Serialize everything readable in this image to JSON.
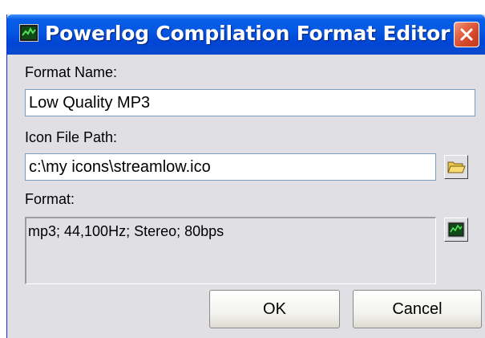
{
  "window": {
    "title": "Powerlog Compilation Format Editor",
    "app_icon": "chart-icon",
    "close_icon": "close-icon"
  },
  "fields": {
    "format_name": {
      "label": "Format Name:",
      "value": "Low Quality MP3"
    },
    "icon_file_path": {
      "label": "Icon File Path:",
      "value": "c:\\my icons\\streamlow.ico",
      "browse_icon": "folder-icon"
    },
    "format": {
      "label": "Format:",
      "value": "mp3; 44,100Hz; Stereo; 80bps",
      "edit_icon": "chart-icon"
    }
  },
  "buttons": {
    "ok": "OK",
    "cancel": "Cancel"
  },
  "colors": {
    "titlebar": "#0054e3",
    "close_button": "#d3462a",
    "dialog_face": "#e0dfe3",
    "input_border": "#7f9db9"
  }
}
